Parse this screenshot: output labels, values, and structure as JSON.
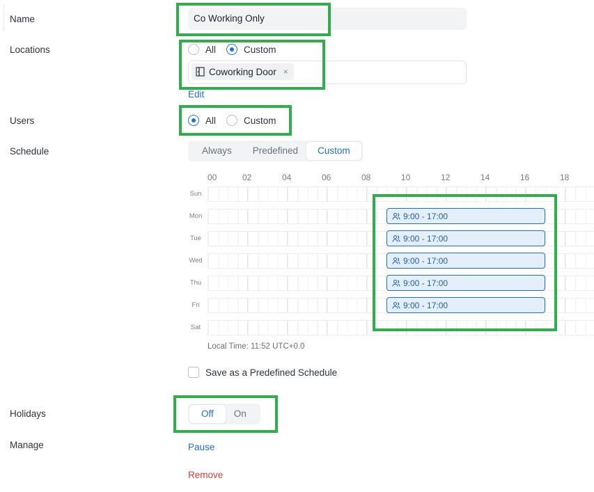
{
  "labels": {
    "name": "Name",
    "locations": "Locations",
    "users": "Users",
    "schedule": "Schedule",
    "holidays": "Holidays",
    "manage": "Manage"
  },
  "name_field": {
    "value": "Co Working Only"
  },
  "locations": {
    "options": [
      "All",
      "Custom"
    ],
    "selected": "Custom",
    "chips": [
      {
        "label": "Coworking Door",
        "icon": "door-icon",
        "remove": "×"
      }
    ],
    "edit_link": "Edit"
  },
  "users": {
    "options": [
      "All",
      "Custom"
    ],
    "selected": "All"
  },
  "schedule": {
    "tabs": [
      "Always",
      "Predefined",
      "Custom"
    ],
    "active_tab": "Custom",
    "hours": [
      "00",
      "02",
      "04",
      "06",
      "08",
      "10",
      "12",
      "14",
      "16",
      "18"
    ],
    "days": [
      "Sun",
      "Mon",
      "Tue",
      "Wed",
      "Thu",
      "Fri",
      "Sat"
    ],
    "slots": [
      {
        "day": "Mon",
        "label": "9:00 - 17:00",
        "icon": "users-icon"
      },
      {
        "day": "Tue",
        "label": "9:00 - 17:00",
        "icon": "users-icon"
      },
      {
        "day": "Wed",
        "label": "9:00 - 17:00",
        "icon": "users-icon"
      },
      {
        "day": "Thu",
        "label": "9:00 - 17:00",
        "icon": "users-icon"
      },
      {
        "day": "Fri",
        "label": "9:00 - 17:00",
        "icon": "users-icon"
      }
    ],
    "local_time": "Local Time: 11:52 UTC+0.0",
    "save_predefined_label": "Save as a Predefined Schedule"
  },
  "holidays": {
    "options": [
      "Off",
      "On"
    ],
    "selected": "Off"
  },
  "manage": {
    "pause": "Pause",
    "remove": "Remove"
  },
  "colors": {
    "accent": "#1f6fd6",
    "danger": "#e23b3b",
    "highlight": "#2fae4b",
    "slot_fill": "#e4effc"
  }
}
